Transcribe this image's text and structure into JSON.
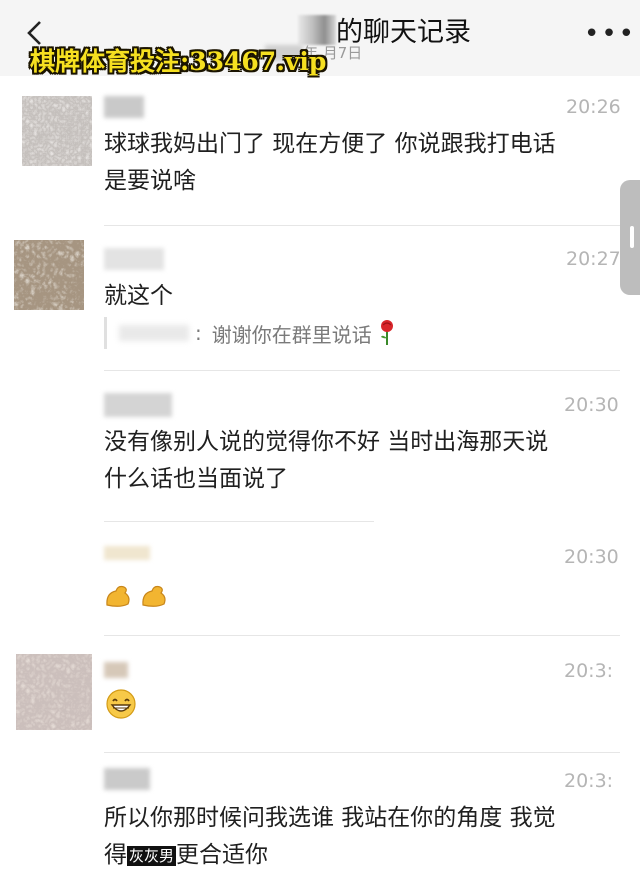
{
  "header": {
    "title_suffix": "的聊天记录",
    "subtitle_partial": "年 月7日",
    "more_label": "•••"
  },
  "watermark": {
    "text": "棋牌体育投注:33467.vip"
  },
  "messages": [
    {
      "time": "20:26",
      "text": "球球我妈出门了 现在方便了 你说跟我打电话\n是要说啥"
    },
    {
      "time": "20:27",
      "text": "就这个",
      "quote": {
        "separator": ":",
        "text": "谢谢你在群里说话"
      }
    },
    {
      "time": "20:30",
      "text": "没有像别人说的觉得你不好 当时出海那天说\n什么话也当面说了"
    },
    {
      "time": "20:30",
      "emoji": [
        "flexed-biceps",
        "flexed-biceps"
      ]
    },
    {
      "time": "20:3:",
      "emoji": [
        "grinning-face"
      ]
    },
    {
      "time": "20:3:",
      "text_a": "所以你那时候问我选谁 我站在你的角度 我觉\n得",
      "censor": "灰灰男",
      "text_b": "更合适你"
    }
  ],
  "colors": {
    "watermark": "#f6e020",
    "header_bg": "#f5f5f5",
    "time": "#b5b5b5"
  },
  "icons": [
    "back-chevron-icon",
    "more-dots-icon",
    "rose-icon",
    "flexed-biceps-icon",
    "grinning-face-icon"
  ]
}
